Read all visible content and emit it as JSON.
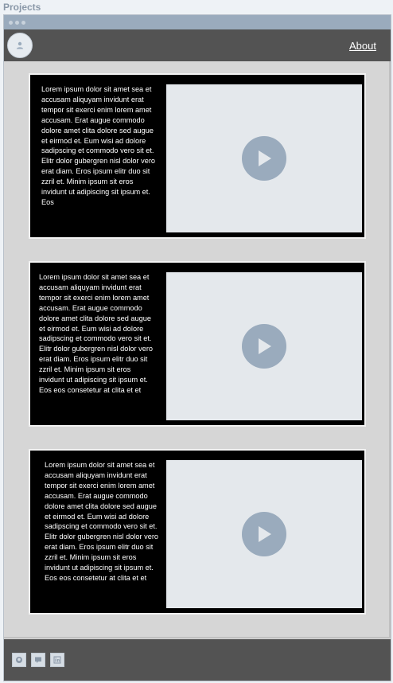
{
  "page": {
    "title": "Projects"
  },
  "header": {
    "about_label": "About"
  },
  "cards": [
    {
      "text": "Lorem ipsum dolor sit amet sea et accusam aliquyam invidunt erat tempor sit exerci enim lorem amet accusam. Erat augue commodo dolore amet clita dolore sed augue et eirmod et. Eum wisi ad dolore sadipscing et commodo vero sit et. Elitr dolor gubergren nisl dolor vero erat diam. Eros ipsum elitr duo sit zzril et. Minim ipsum sit eros invidunt ut adipiscing sit ipsum et. Eos"
    },
    {
      "text": "Lorem ipsum dolor sit amet sea et accusam aliquyam invidunt erat tempor sit exerci enim lorem amet accusam. Erat augue commodo dolore amet clita dolore sed augue et eirmod et. Eum wisi ad dolore sadipscing et commodo vero sit et. Elitr dolor gubergren nisl dolor vero erat diam. Eros ipsum elitr duo sit zzril et. Minim ipsum sit eros invidunt ut adipiscing sit ipsum et. Eos eos consetetur at clita et et"
    },
    {
      "text": "Lorem ipsum dolor sit amet sea et accusam aliquyam invidunt erat tempor sit exerci enim lorem amet accusam. Erat augue commodo dolore amet clita dolore sed augue et eirmod et. Eum wisi ad dolore sadipscing et commodo vero sit et. Elitr dolor gubergren nisl dolor vero erat diam. Eros ipsum elitr duo sit zzril et. Minim ipsum sit eros invidunt ut adipiscing sit ipsum et. Eos eos consetetur at clita et et"
    }
  ],
  "footer": {
    "icons": [
      "github-icon",
      "chat-icon",
      "linkedin-icon"
    ]
  },
  "colors": {
    "header": "#535353",
    "accent": "#9aabbd",
    "card": "#000000"
  }
}
